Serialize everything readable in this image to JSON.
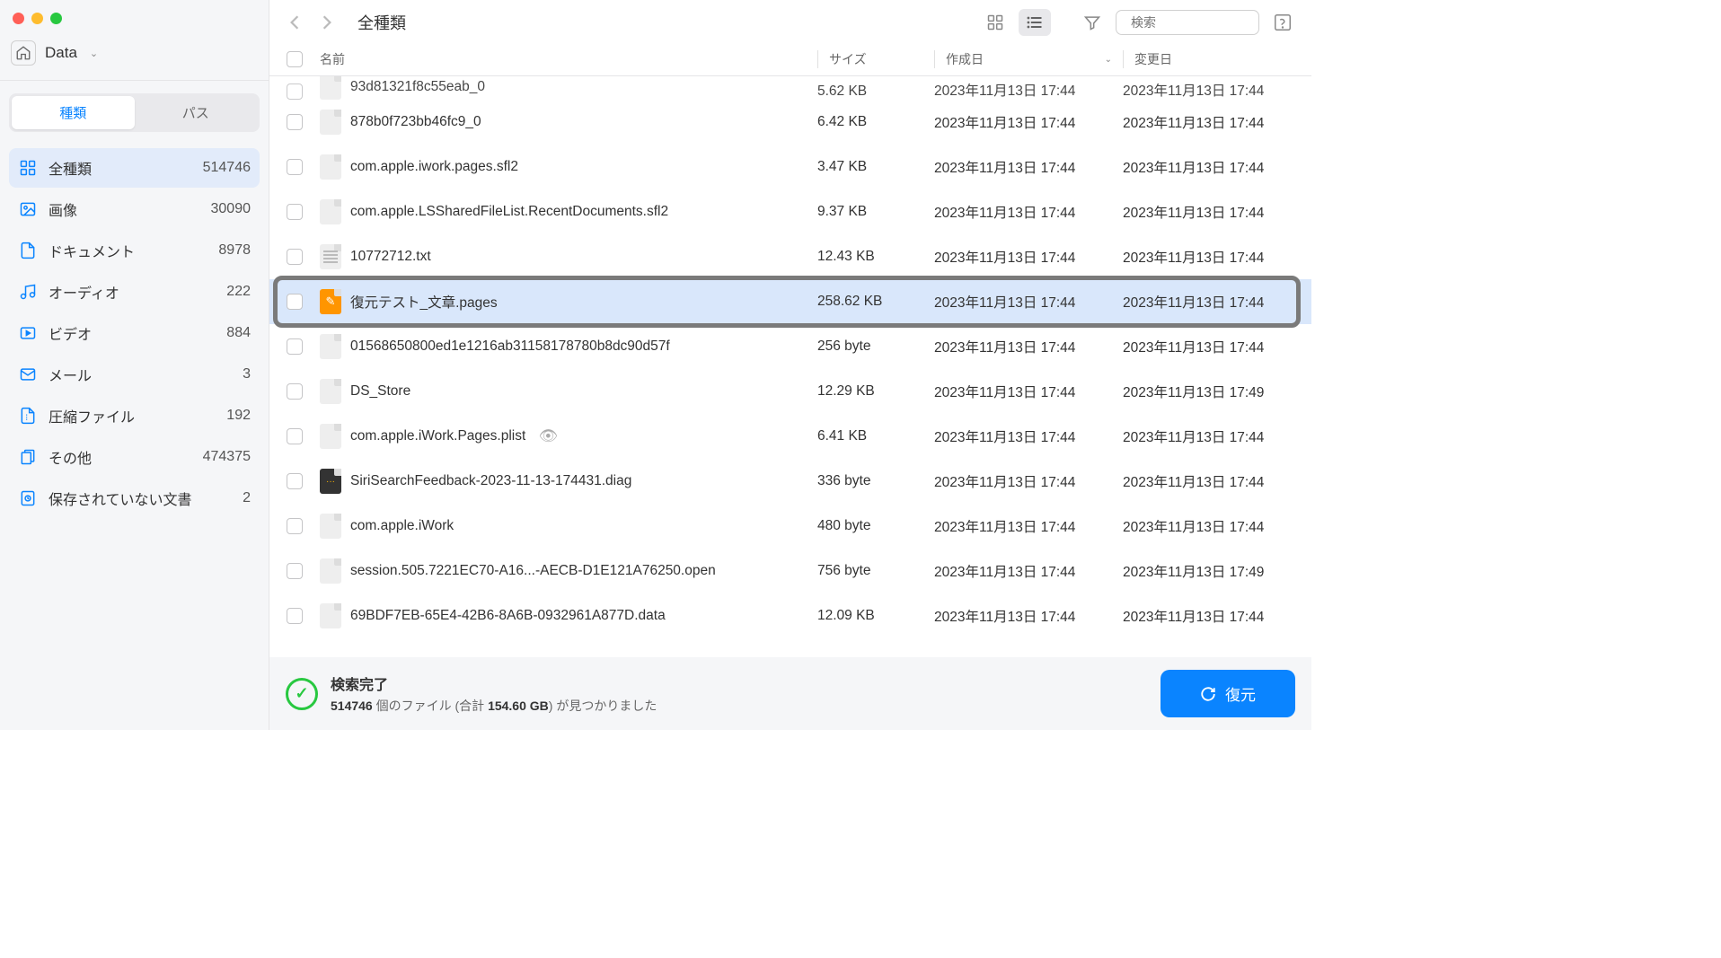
{
  "location": {
    "name": "Data"
  },
  "tabs": {
    "kind": "種類",
    "path": "パス"
  },
  "categories": [
    {
      "key": "all",
      "label": "全種類",
      "count": "514746",
      "active": true
    },
    {
      "key": "image",
      "label": "画像",
      "count": "30090"
    },
    {
      "key": "document",
      "label": "ドキュメント",
      "count": "8978"
    },
    {
      "key": "audio",
      "label": "オーディオ",
      "count": "222"
    },
    {
      "key": "video",
      "label": "ビデオ",
      "count": "884"
    },
    {
      "key": "mail",
      "label": "メール",
      "count": "3"
    },
    {
      "key": "archive",
      "label": "圧縮ファイル",
      "count": "192"
    },
    {
      "key": "other",
      "label": "その他",
      "count": "474375"
    },
    {
      "key": "unsaved",
      "label": "保存されていない文書",
      "count": "2"
    }
  ],
  "toolbar": {
    "title": "全種類",
    "search_placeholder": "検索"
  },
  "columns": {
    "name": "名前",
    "size": "サイズ",
    "created": "作成日",
    "modified": "変更日"
  },
  "files": [
    {
      "name": "93d81321f8c55eab_0",
      "size": "5.62 KB",
      "created": "2023年11月13日 17:44",
      "modified": "2023年11月13日 17:44",
      "icon": "file",
      "partial_top": true
    },
    {
      "name": "878b0f723bb46fc9_0",
      "size": "6.42 KB",
      "created": "2023年11月13日 17:44",
      "modified": "2023年11月13日 17:44",
      "icon": "file"
    },
    {
      "name": "com.apple.iwork.pages.sfl2",
      "size": "3.47 KB",
      "created": "2023年11月13日 17:44",
      "modified": "2023年11月13日 17:44",
      "icon": "file"
    },
    {
      "name": "com.apple.LSSharedFileList.RecentDocuments.sfl2",
      "size": "9.37 KB",
      "created": "2023年11月13日 17:44",
      "modified": "2023年11月13日 17:44",
      "icon": "file"
    },
    {
      "name": "10772712.txt",
      "size": "12.43 KB",
      "created": "2023年11月13日 17:44",
      "modified": "2023年11月13日 17:44",
      "icon": "txt"
    },
    {
      "name": "復元テスト_文章.pages",
      "size": "258.62 KB",
      "created": "2023年11月13日 17:44",
      "modified": "2023年11月13日 17:44",
      "icon": "pages",
      "highlighted": true
    },
    {
      "name": "01568650800ed1e1216ab31158178780b8dc90d57f",
      "size": "256 byte",
      "created": "2023年11月13日 17:44",
      "modified": "2023年11月13日 17:44",
      "icon": "file"
    },
    {
      "name": "DS_Store",
      "size": "12.29 KB",
      "created": "2023年11月13日 17:44",
      "modified": "2023年11月13日 17:49",
      "icon": "file"
    },
    {
      "name": "com.apple.iWork.Pages.plist",
      "size": "6.41 KB",
      "created": "2023年11月13日 17:44",
      "modified": "2023年11月13日 17:44",
      "icon": "file",
      "preview": true
    },
    {
      "name": "SiriSearchFeedback-2023-11-13-174431.diag",
      "size": "336 byte",
      "created": "2023年11月13日 17:44",
      "modified": "2023年11月13日 17:44",
      "icon": "diag"
    },
    {
      "name": "com.apple.iWork",
      "size": "480 byte",
      "created": "2023年11月13日 17:44",
      "modified": "2023年11月13日 17:44",
      "icon": "file"
    },
    {
      "name": "session.505.7221EC70-A16...-AECB-D1E121A76250.open",
      "size": "756 byte",
      "created": "2023年11月13日 17:44",
      "modified": "2023年11月13日 17:49",
      "icon": "file"
    },
    {
      "name": "69BDF7EB-65E4-42B6-8A6B-0932961A877D.data",
      "size": "12.09 KB",
      "created": "2023年11月13日 17:44",
      "modified": "2023年11月13日 17:44",
      "icon": "file"
    }
  ],
  "status": {
    "title": "検索完了",
    "count": "514746",
    "count_suffix": " 個のファイル (合計 ",
    "total_size": "154.60 GB",
    "size_suffix": ") が見つかりました"
  },
  "recover_button": "復元"
}
